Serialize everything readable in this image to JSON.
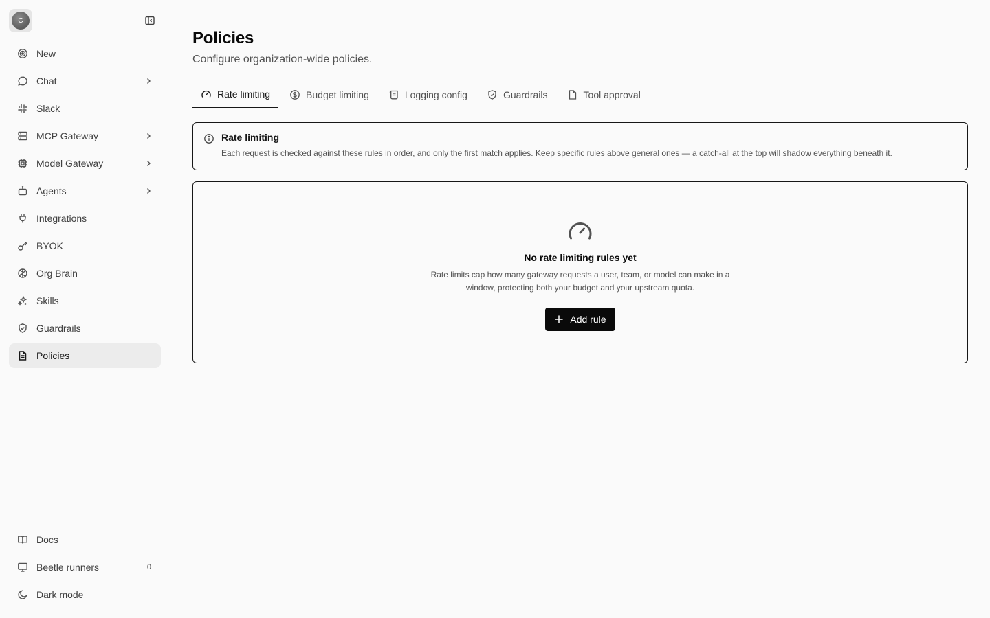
{
  "sidebar": {
    "avatar_initial": "C",
    "items": [
      {
        "label": "New",
        "icon": "target-icon"
      },
      {
        "label": "Chat",
        "icon": "chat-icon"
      },
      {
        "label": "Slack",
        "icon": "slack-icon"
      },
      {
        "label": "MCP Gateway",
        "icon": "server-icon"
      },
      {
        "label": "Model Gateway",
        "icon": "cpu-icon"
      },
      {
        "label": "Agents",
        "icon": "bot-icon"
      },
      {
        "label": "Integrations",
        "icon": "plug-icon"
      },
      {
        "label": "BYOK",
        "icon": "key-icon"
      },
      {
        "label": "Org Brain",
        "icon": "brain-icon"
      },
      {
        "label": "Skills",
        "icon": "sparkles-icon"
      },
      {
        "label": "Guardrails",
        "icon": "shield-icon"
      },
      {
        "label": "Policies",
        "icon": "document-icon"
      }
    ],
    "bottom": {
      "docs": "Docs",
      "runners": "Beetle runners",
      "runners_count": "0",
      "dark_mode": "Dark mode"
    }
  },
  "main": {
    "title": "Policies",
    "subtitle": "Configure organization-wide policies.",
    "tabs": [
      {
        "label": "Rate limiting",
        "icon": "gauge-icon"
      },
      {
        "label": "Budget limiting",
        "icon": "dollar-icon"
      },
      {
        "label": "Logging config",
        "icon": "scroll-icon"
      },
      {
        "label": "Guardrails",
        "icon": "shield-check-icon"
      },
      {
        "label": "Tool approval",
        "icon": "file-icon"
      }
    ],
    "active_tab": "Rate limiting",
    "info": {
      "title": "Rate limiting",
      "text": "Each request is checked against these rules in order, and only the first match applies. Keep specific rules above general ones — a catch-all at the top will shadow everything beneath it."
    },
    "empty": {
      "title": "No rate limiting rules yet",
      "text": "Rate limits cap how many gateway requests a user, team, or model can make in a window, protecting both your budget and your upstream quota.",
      "button": "Add rule"
    }
  },
  "colors": {
    "accent": "#0a0a0a",
    "sidebar_active": "#ececec",
    "background": "#fafafa"
  }
}
